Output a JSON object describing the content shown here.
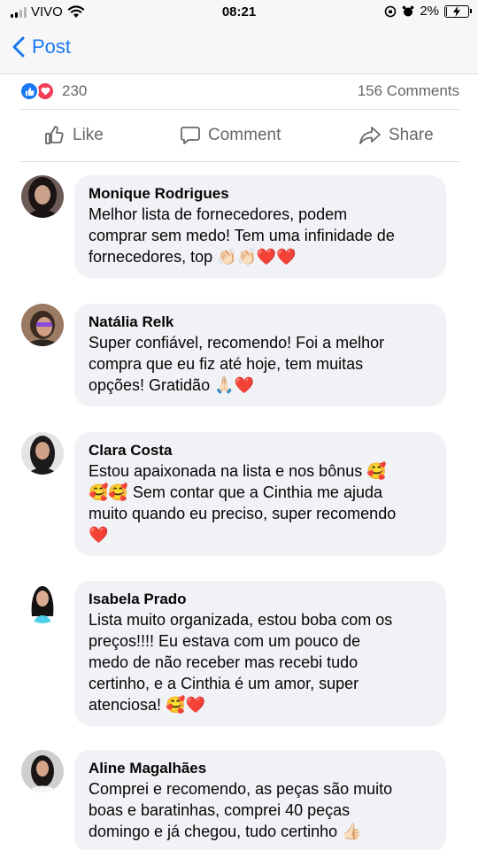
{
  "status_bar": {
    "carrier": "VIVO",
    "time": "08:21",
    "battery": "2%",
    "battery_level": 0.02
  },
  "nav": {
    "back_label": "Post"
  },
  "reactions": {
    "count": "230",
    "comments": "156 Comments"
  },
  "actions": {
    "like": "Like",
    "comment": "Comment",
    "share": "Share"
  },
  "comments": [
    {
      "author": "Monique Rodrigues",
      "lines": [
        "Melhor lista de fornecedores, podem",
        "comprar sem medo! Tem uma infinidade de",
        "fornecedores, top 👏🏻👏🏻❤️❤️"
      ]
    },
    {
      "author": "Natália Relk",
      "lines": [
        "Super confiável, recomendo! Foi a melhor",
        "compra que eu fiz até hoje, tem muitas",
        "opções! Gratidão 🙏🏻❤️"
      ]
    },
    {
      "author": "Clara Costa",
      "lines": [
        "Estou apaixonada na lista e nos bônus 🥰",
        "🥰🥰 Sem contar que a Cinthia me ajuda",
        "muito quando eu preciso, super recomendo",
        "❤️"
      ]
    },
    {
      "author": "Isabela Prado",
      "lines": [
        "Lista muito organizada, estou boba com os",
        "preços!!!! Eu estava com um pouco de",
        "medo de não receber mas recebi tudo",
        "certinho, e a Cinthia é um amor, super",
        "atenciosa! 🥰❤️"
      ]
    },
    {
      "author": "Aline Magalhães",
      "lines": [
        "Comprei e recomendo, as peças são muito",
        "boas e baratinhas, comprei 40 peças",
        "domingo e já chegou, tudo certinho 👍🏻"
      ]
    }
  ]
}
